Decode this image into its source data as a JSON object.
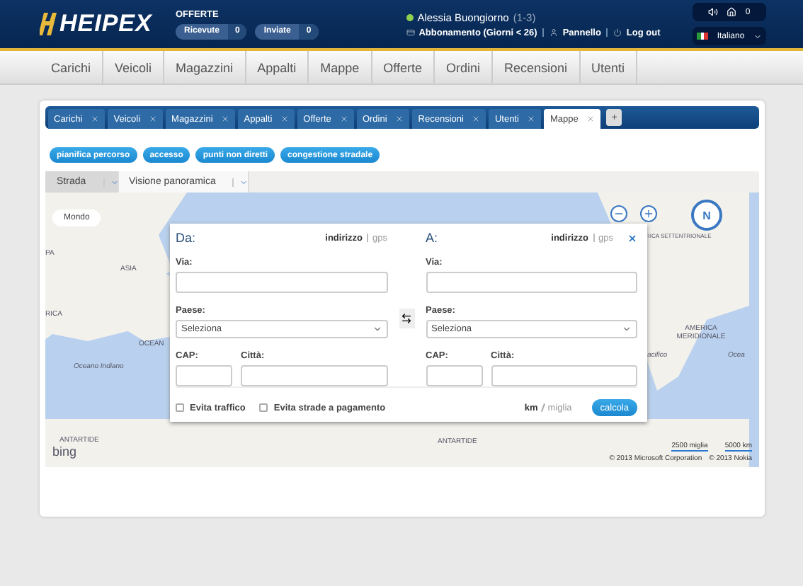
{
  "header": {
    "logo": "HEIPEX",
    "offers": {
      "title": "OFFERTE",
      "pills": [
        {
          "label": "Ricevute",
          "count": "0"
        },
        {
          "label": "Inviate",
          "count": "0"
        }
      ]
    },
    "user": {
      "name": "Alessia Buongiorno",
      "range": "(1-3)",
      "online": true,
      "subscription": "Abbonamento (Giorni < 26)",
      "links": [
        "Pannello",
        "Log out"
      ]
    },
    "notifications": "0",
    "language": "Italiano"
  },
  "nav": [
    "Carichi",
    "Veicoli",
    "Magazzini",
    "Appalti",
    "Mappe",
    "Offerte",
    "Ordini",
    "Recensioni",
    "Utenti"
  ],
  "tabs": [
    {
      "label": "Carichi",
      "selected": false
    },
    {
      "label": "Veicoli",
      "selected": false
    },
    {
      "label": "Magazzini",
      "selected": false
    },
    {
      "label": "Appalti",
      "selected": false
    },
    {
      "label": "Offerte",
      "selected": false
    },
    {
      "label": "Ordini",
      "selected": false
    },
    {
      "label": "Recensioni",
      "selected": false
    },
    {
      "label": "Utenti",
      "selected": false
    },
    {
      "label": "Mappe",
      "selected": true
    }
  ],
  "add_tab": "+",
  "actions": [
    "pianifica percorso",
    "accesso",
    "punti non diretti",
    "congestione stradale"
  ],
  "map": {
    "view_tabs": [
      {
        "label": "Strada",
        "selected": true
      },
      {
        "label": "Visione panoramica",
        "selected": false
      }
    ],
    "scope": "Mondo",
    "compass": "N",
    "brand": "bing",
    "labels": [
      "PA",
      "ASIA",
      "RICA",
      "OCEAN",
      "Oceano Indiano",
      "ANTARTIDE",
      "ANTARTIDE",
      "RICA SETTENTRIONALE",
      "AMERICA MERIDIONALE",
      "acifico",
      "Ocea"
    ],
    "scale": [
      "2500 miglia",
      "5000 km"
    ],
    "credits": [
      "© 2013 Microsoft Corporation",
      "© 2013 Nokia"
    ]
  },
  "route": {
    "ends": [
      {
        "title": "Da:",
        "modes": [
          {
            "label": "indirizzo",
            "selected": true
          },
          {
            "label": "gps",
            "selected": false
          }
        ],
        "street": "Via:",
        "country": "Paese:",
        "country_value": "Seleziona",
        "zip": "CAP:",
        "city": "Città:"
      },
      {
        "title": "A:",
        "modes": [
          {
            "label": "indirizzo",
            "selected": true
          },
          {
            "label": "gps",
            "selected": false
          }
        ],
        "street": "Via:",
        "country": "Paese:",
        "country_value": "Seleziona",
        "zip": "CAP:",
        "city": "Città:"
      }
    ],
    "options": [
      {
        "label": "Evita traffico",
        "checked": false
      },
      {
        "label": "Evita strade a pagamento",
        "checked": false
      }
    ],
    "units": [
      {
        "label": "km",
        "selected": true
      },
      {
        "label": "miglia",
        "selected": false
      }
    ],
    "submit": "calcola"
  }
}
